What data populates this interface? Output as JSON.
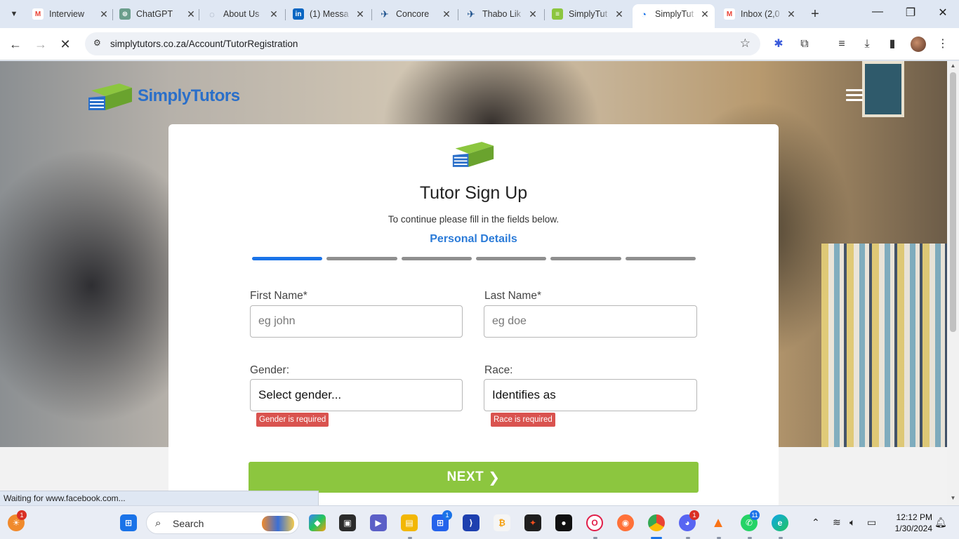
{
  "browser": {
    "tabs": [
      {
        "title": "Interview",
        "favicon": "gmail-icon",
        "color": "#ea4335"
      },
      {
        "title": "ChatGPT",
        "favicon": "chatgpt-icon",
        "color": "#6b9e8c"
      },
      {
        "title": "About Us",
        "favicon": "loading-icon",
        "color": "#8a94a6"
      },
      {
        "title": "(1) Messa",
        "favicon": "linkedin-icon",
        "color": "#0a66c2"
      },
      {
        "title": "Concore",
        "favicon": "concore-icon",
        "color": "#1a4f8b"
      },
      {
        "title": "Thabo Lik",
        "favicon": "concore-icon",
        "color": "#1a4f8b"
      },
      {
        "title": "SimplyTut",
        "favicon": "simplytutors-icon",
        "color": "#8cc63f"
      },
      {
        "title": "SimplyTut",
        "favicon": "loading-icon",
        "color": "#1a73e8",
        "active": true
      },
      {
        "title": "Inbox (2,0",
        "favicon": "gmail-icon",
        "color": "#ea4335"
      }
    ],
    "url": "simplytutors.co.za/Account/TutorRegistration",
    "status_text": "Waiting for www.facebook.com..."
  },
  "site": {
    "brand": "SimplyTutors"
  },
  "form": {
    "title": "Tutor Sign Up",
    "subtitle": "To continue please fill in the fields below.",
    "step_title": "Personal Details",
    "steps_total": 6,
    "current_step": 1,
    "first_name": {
      "label": "First Name*",
      "placeholder": "eg john",
      "value": ""
    },
    "last_name": {
      "label": "Last Name*",
      "placeholder": "eg doe",
      "value": ""
    },
    "gender": {
      "label": "Gender:",
      "selected": "Select gender...",
      "error": "Gender is required"
    },
    "race": {
      "label": "Race:",
      "selected": "Identifies as",
      "error": "Race is required"
    },
    "next_label": "NEXT"
  },
  "taskbar": {
    "search_label": "Search",
    "clock_time": "12:12 PM",
    "clock_date": "1/30/2024",
    "badges": {
      "widgets": "1",
      "store": "1",
      "discord": "1",
      "whatsapp": "11"
    }
  }
}
